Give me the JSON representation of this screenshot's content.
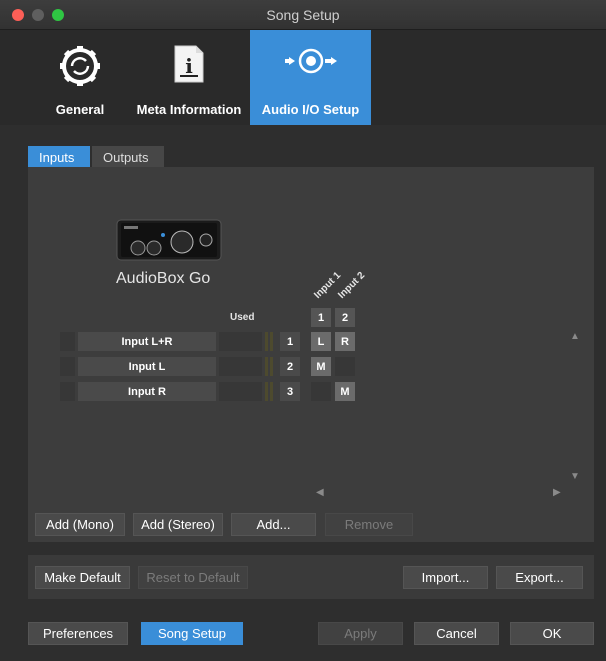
{
  "window": {
    "title": "Song Setup"
  },
  "toolbar": {
    "items": [
      {
        "label": "General",
        "icon": "gear-sync-icon"
      },
      {
        "label": "Meta Information",
        "icon": "info-document-icon"
      },
      {
        "label": "Audio I/O Setup",
        "icon": "speaker-io-icon",
        "selected": true
      }
    ]
  },
  "tabs": [
    {
      "label": "Inputs",
      "selected": true
    },
    {
      "label": "Outputs"
    }
  ],
  "device": {
    "name": "AudioBox Go"
  },
  "matrix": {
    "column_headers": [
      "Input 1",
      "Input 2"
    ],
    "column_numbers": [
      "1",
      "2"
    ],
    "used_label": "Used",
    "rows": [
      {
        "name": "Input L+R",
        "num": "1",
        "c1": "L",
        "c2": "R"
      },
      {
        "name": "Input L",
        "num": "2",
        "c1": "M",
        "c2": ""
      },
      {
        "name": "Input R",
        "num": "3",
        "c1": "",
        "c2": "M"
      }
    ]
  },
  "buttons": {
    "add_mono": "Add (Mono)",
    "add_stereo": "Add (Stereo)",
    "add": "Add...",
    "remove": "Remove",
    "make_default": "Make Default",
    "reset_default": "Reset to Default",
    "import": "Import...",
    "export": "Export...",
    "preferences": "Preferences",
    "song_setup": "Song Setup",
    "apply": "Apply",
    "cancel": "Cancel",
    "ok": "OK"
  },
  "colors": {
    "accent": "#3a8ed8",
    "background": "#2b2b2b"
  }
}
